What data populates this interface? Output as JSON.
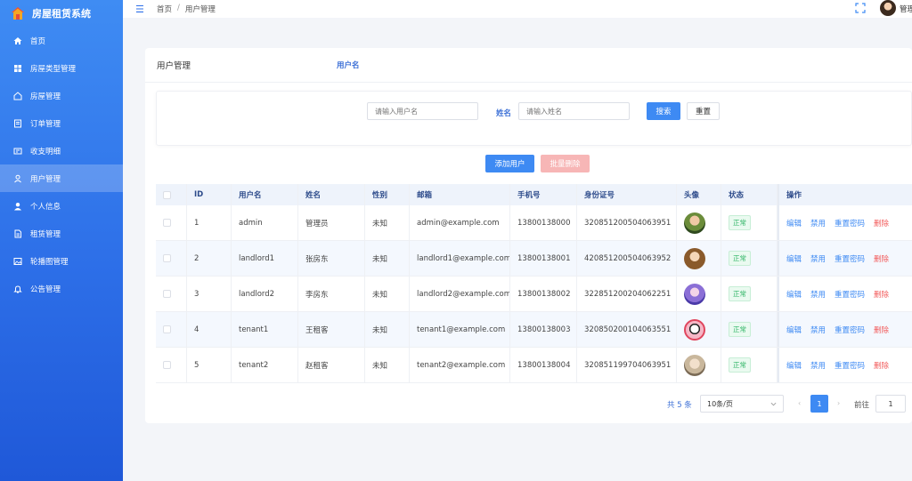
{
  "app": {
    "title": "房屋租赁系统"
  },
  "sidebar": {
    "items": [
      {
        "label": "首页",
        "icon": "home-icon"
      },
      {
        "label": "房屋类型管理",
        "icon": "grid-icon"
      },
      {
        "label": "房屋管理",
        "icon": "house-icon"
      },
      {
        "label": "订单管理",
        "icon": "document-icon"
      },
      {
        "label": "收支明细",
        "icon": "wallet-icon"
      },
      {
        "label": "用户管理",
        "icon": "user-icon",
        "active": true
      },
      {
        "label": "个人信息",
        "icon": "person-icon"
      },
      {
        "label": "租赁管理",
        "icon": "file-icon"
      },
      {
        "label": "轮播图管理",
        "icon": "image-icon"
      },
      {
        "label": "公告管理",
        "icon": "bell-icon"
      }
    ]
  },
  "header": {
    "breadcrumb": [
      "首页",
      "用户管理"
    ],
    "breadcrumb_sep": "/",
    "user": "管理员"
  },
  "card": {
    "title": "用户管理"
  },
  "search": {
    "username_label": "用户名",
    "username_placeholder": "请输入用户名",
    "name_label": "姓名",
    "name_placeholder": "请输入姓名",
    "search_button": "搜索",
    "reset_button": "重置"
  },
  "actions": {
    "add_button": "添加用户",
    "batch_delete_button": "批量删除"
  },
  "table": {
    "columns": [
      "ID",
      "用户名",
      "姓名",
      "性别",
      "邮箱",
      "手机号",
      "身份证号",
      "头像",
      "状态",
      "操作"
    ],
    "rows": [
      {
        "id": "1",
        "username": "admin",
        "name": "管理员",
        "gender": "未知",
        "email": "admin@example.com",
        "phone": "13800138000",
        "idcard": "320851200504063951",
        "status": "正常"
      },
      {
        "id": "2",
        "username": "landlord1",
        "name": "张房东",
        "gender": "未知",
        "email": "landlord1@example.com",
        "phone": "13800138001",
        "idcard": "420851200504063952",
        "status": "正常"
      },
      {
        "id": "3",
        "username": "landlord2",
        "name": "李房东",
        "gender": "未知",
        "email": "landlord2@example.com",
        "phone": "13800138002",
        "idcard": "322851200204062251",
        "status": "正常"
      },
      {
        "id": "4",
        "username": "tenant1",
        "name": "王租客",
        "gender": "未知",
        "email": "tenant1@example.com",
        "phone": "13800138003",
        "idcard": "320850200104063551",
        "status": "正常"
      },
      {
        "id": "5",
        "username": "tenant2",
        "name": "赵租客",
        "gender": "未知",
        "email": "tenant2@example.com",
        "phone": "13800138004",
        "idcard": "320851199704063951",
        "status": "正常"
      }
    ],
    "ops": {
      "edit": "编辑",
      "disable": "禁用",
      "reset_password": "重置密码",
      "delete": "删除"
    }
  },
  "pagination": {
    "total": "共 5 条",
    "page_size": "10条/页",
    "current_page": "1",
    "goto_label": "前往",
    "goto_value": "1"
  },
  "colors": {
    "primary": "#3e8af3",
    "sidebar": "#2d6fe8",
    "danger": "#f25b5b",
    "success": "#2fb465"
  }
}
